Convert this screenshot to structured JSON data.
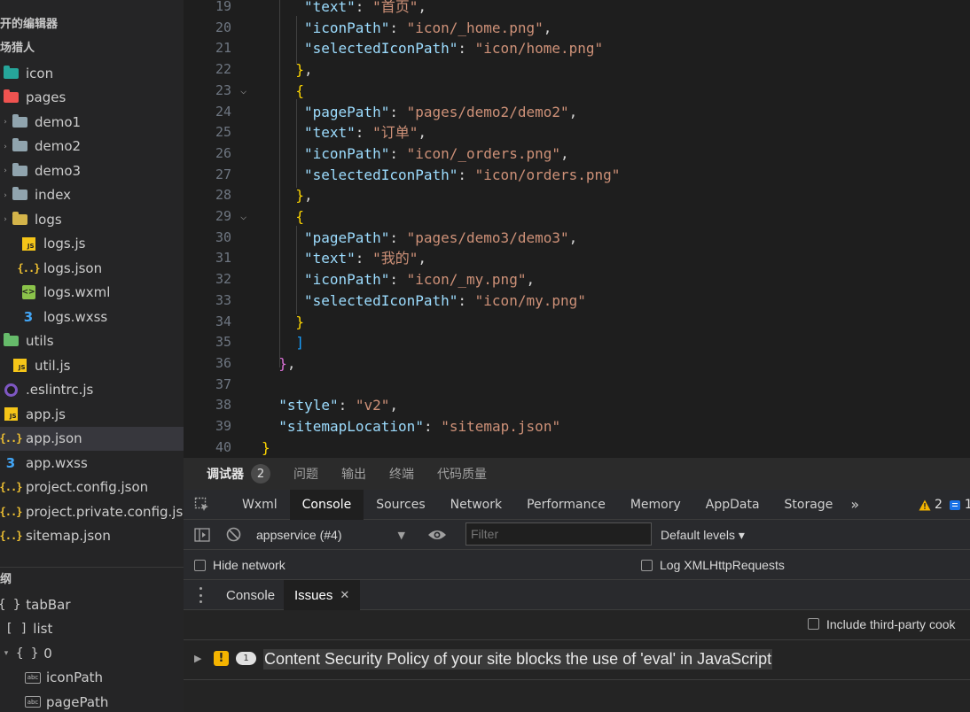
{
  "sidebar": {
    "open_editors_label": "开的编辑器",
    "project_label": "场猎人",
    "tree": [
      {
        "label": "icon",
        "icon": "folder-icon",
        "kind": "icon-folder"
      },
      {
        "label": "pages",
        "icon": "folder-icon",
        "kind": "pages-folder"
      },
      {
        "label": "demo1",
        "icon": "folder-icon",
        "kind": "folder"
      },
      {
        "label": "demo2",
        "icon": "folder-icon",
        "kind": "folder"
      },
      {
        "label": "demo3",
        "icon": "folder-icon",
        "kind": "folder"
      },
      {
        "label": "index",
        "icon": "folder-icon",
        "kind": "folder"
      },
      {
        "label": "logs",
        "icon": "folder-open-icon",
        "kind": "logs-folder"
      },
      {
        "label": "logs.js",
        "icon": "js-file-icon",
        "kind": "js"
      },
      {
        "label": "logs.json",
        "icon": "json-file-icon",
        "kind": "json"
      },
      {
        "label": "logs.wxml",
        "icon": "wxml-file-icon",
        "kind": "wxml"
      },
      {
        "label": "logs.wxss",
        "icon": "css-file-icon",
        "kind": "wxss"
      },
      {
        "label": "utils",
        "icon": "folder-open-icon",
        "kind": "utils-folder"
      },
      {
        "label": "util.js",
        "icon": "js-file-icon",
        "kind": "js"
      },
      {
        "label": ".eslintrc.js",
        "icon": "eslint-icon",
        "kind": "eslint"
      },
      {
        "label": "app.js",
        "icon": "js-file-icon",
        "kind": "js"
      },
      {
        "label": "app.json",
        "icon": "json-file-icon",
        "kind": "json",
        "selected": true
      },
      {
        "label": "app.wxss",
        "icon": "css-file-icon",
        "kind": "wxss"
      },
      {
        "label": "project.config.json",
        "icon": "json-file-icon",
        "kind": "json"
      },
      {
        "label": "project.private.config.js...",
        "icon": "json-file-icon",
        "kind": "json"
      },
      {
        "label": "sitemap.json",
        "icon": "json-file-icon",
        "kind": "json"
      }
    ],
    "outline_label": "纲",
    "outline": [
      {
        "symbol": "{ }",
        "label": "tabBar"
      },
      {
        "symbol": "[ ]",
        "label": "list"
      },
      {
        "symbol": "{ }",
        "label": "0"
      },
      {
        "symbol": "abc",
        "label": "iconPath"
      },
      {
        "symbol": "abc",
        "label": "pagePath"
      }
    ]
  },
  "editor": {
    "lines": [
      {
        "n": "19",
        "indent": 5,
        "tokens": [
          [
            "k",
            "\"text\""
          ],
          [
            "p",
            ": "
          ],
          [
            "s",
            "\"首页\""
          ],
          [
            "p",
            ","
          ]
        ]
      },
      {
        "n": "20",
        "indent": 5,
        "tokens": [
          [
            "k",
            "\"iconPath\""
          ],
          [
            "p",
            ": "
          ],
          [
            "s",
            "\"icon/_home.png\""
          ],
          [
            "p",
            ","
          ]
        ]
      },
      {
        "n": "21",
        "indent": 5,
        "tokens": [
          [
            "k",
            "\"selectedIconPath\""
          ],
          [
            "p",
            ": "
          ],
          [
            "s",
            "\"icon/home.png\""
          ]
        ]
      },
      {
        "n": "22",
        "indent": 4,
        "tokens": [
          [
            "b1",
            "}"
          ],
          [
            "p",
            ","
          ]
        ]
      },
      {
        "n": "23",
        "indent": 4,
        "fold": true,
        "tokens": [
          [
            "b1",
            "{"
          ]
        ]
      },
      {
        "n": "24",
        "indent": 5,
        "tokens": [
          [
            "k",
            "\"pagePath\""
          ],
          [
            "p",
            ": "
          ],
          [
            "s",
            "\"pages/demo2/demo2\""
          ],
          [
            "p",
            ","
          ]
        ]
      },
      {
        "n": "25",
        "indent": 5,
        "tokens": [
          [
            "k",
            "\"text\""
          ],
          [
            "p",
            ": "
          ],
          [
            "s",
            "\"订单\""
          ],
          [
            "p",
            ","
          ]
        ]
      },
      {
        "n": "26",
        "indent": 5,
        "tokens": [
          [
            "k",
            "\"iconPath\""
          ],
          [
            "p",
            ": "
          ],
          [
            "s",
            "\"icon/_orders.png\""
          ],
          [
            "p",
            ","
          ]
        ]
      },
      {
        "n": "27",
        "indent": 5,
        "tokens": [
          [
            "k",
            "\"selectedIconPath\""
          ],
          [
            "p",
            ": "
          ],
          [
            "s",
            "\"icon/orders.png\""
          ]
        ]
      },
      {
        "n": "28",
        "indent": 4,
        "tokens": [
          [
            "b1",
            "}"
          ],
          [
            "p",
            ","
          ]
        ]
      },
      {
        "n": "29",
        "indent": 4,
        "fold": true,
        "tokens": [
          [
            "b1",
            "{"
          ]
        ]
      },
      {
        "n": "30",
        "indent": 5,
        "tokens": [
          [
            "k",
            "\"pagePath\""
          ],
          [
            "p",
            ": "
          ],
          [
            "s",
            "\"pages/demo3/demo3\""
          ],
          [
            "p",
            ","
          ]
        ]
      },
      {
        "n": "31",
        "indent": 5,
        "tokens": [
          [
            "k",
            "\"text\""
          ],
          [
            "p",
            ": "
          ],
          [
            "s",
            "\"我的\""
          ],
          [
            "p",
            ","
          ]
        ]
      },
      {
        "n": "32",
        "indent": 5,
        "tokens": [
          [
            "k",
            "\"iconPath\""
          ],
          [
            "p",
            ": "
          ],
          [
            "s",
            "\"icon/_my.png\""
          ],
          [
            "p",
            ","
          ]
        ]
      },
      {
        "n": "33",
        "indent": 5,
        "tokens": [
          [
            "k",
            "\"selectedIconPath\""
          ],
          [
            "p",
            ": "
          ],
          [
            "s",
            "\"icon/my.png\""
          ]
        ]
      },
      {
        "n": "34",
        "indent": 4,
        "tokens": [
          [
            "b1",
            "}"
          ]
        ]
      },
      {
        "n": "35",
        "indent": 4,
        "tokens": [
          [
            "b3",
            "]"
          ]
        ]
      },
      {
        "n": "36",
        "indent": 2,
        "tokens": [
          [
            "b2",
            "}"
          ],
          [
            "p",
            ","
          ]
        ]
      },
      {
        "n": "37",
        "indent": 0,
        "tokens": []
      },
      {
        "n": "38",
        "indent": 2,
        "tokens": [
          [
            "k",
            "\"style\""
          ],
          [
            "p",
            ": "
          ],
          [
            "s",
            "\"v2\""
          ],
          [
            "p",
            ","
          ]
        ]
      },
      {
        "n": "39",
        "indent": 2,
        "tokens": [
          [
            "k",
            "\"sitemapLocation\""
          ],
          [
            "p",
            ": "
          ],
          [
            "s",
            "\"sitemap.json\""
          ]
        ]
      },
      {
        "n": "40",
        "indent": 0,
        "tokens": [
          [
            "b1",
            "}"
          ]
        ]
      }
    ]
  },
  "panel": {
    "tabs": [
      "调试器",
      "问题",
      "输出",
      "终端",
      "代码质量"
    ],
    "debugger_badge": "2",
    "devtools_tabs": [
      "Wxml",
      "Console",
      "Sources",
      "Network",
      "Performance",
      "Memory",
      "AppData",
      "Storage"
    ],
    "more_tabs": "»",
    "warnings_count": "2",
    "messages_count": "1",
    "context_select": "appservice (#4)",
    "filter_placeholder": "Filter",
    "levels_select": "Default levels ▾",
    "hide_network_label": "Hide network",
    "log_xhr_label": "Log XMLHttpRequests",
    "drawer_tabs": [
      "Console",
      "Issues"
    ],
    "include_third_party_label": "Include third-party cook",
    "issue": {
      "count": "1",
      "text": "Content Security Policy of your site blocks the use of 'eval' in JavaScript"
    },
    "colors": {
      "warning": "#f4b400",
      "accent_blue": "#1a73e8"
    }
  }
}
